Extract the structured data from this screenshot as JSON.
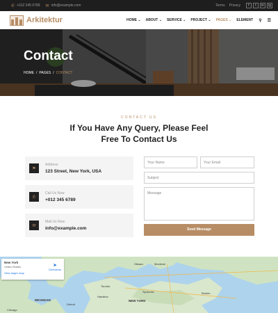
{
  "topbar": {
    "phone": "+012 345 6789",
    "email": "info@example.com",
    "links": [
      "Terms",
      "Privacy"
    ],
    "social": [
      "f",
      "t",
      "in",
      "ig"
    ]
  },
  "brand": {
    "name": "Arkitektur"
  },
  "nav": {
    "items": [
      {
        "label": "HOME ⌄",
        "active": false
      },
      {
        "label": "ABOUT ⌄",
        "active": false
      },
      {
        "label": "SERVICE ⌄",
        "active": false
      },
      {
        "label": "PROJECT ⌄",
        "active": false
      },
      {
        "label": "PAGES ⌄",
        "active": true
      },
      {
        "label": "ELEMENT",
        "active": false
      }
    ]
  },
  "hero": {
    "title": "Contact",
    "breadcrumb": {
      "home": "HOME",
      "sep": "/",
      "pages": "PAGES",
      "current": "CONTACT"
    }
  },
  "section": {
    "eyebrow": "CONTACT US",
    "headline_1": "If You Have Any Query, Please Feel",
    "headline_2": "Free To Contact Us"
  },
  "info": [
    {
      "label": "Address",
      "value": "123 Street, New York, USA",
      "icon": "map-pin-icon"
    },
    {
      "label": "Call Us Now",
      "value": "+012 345 6789",
      "icon": "phone-icon"
    },
    {
      "label": "Mail Us Now",
      "value": "info@example.com",
      "icon": "envelope-icon"
    }
  ],
  "form": {
    "name_placeholder": "Your Name",
    "email_placeholder": "Your Email",
    "subject_placeholder": "Subject",
    "message_placeholder": "Message",
    "submit_label": "Send Message"
  },
  "map": {
    "card_title": "New York",
    "card_subtitle": "United States",
    "card_link": "View larger map",
    "directions": "Directions",
    "labels": [
      "Ottawa",
      "Montreal",
      "Toronto",
      "Detroit",
      "Syracuse",
      "Boston",
      "NEW YORK",
      "MICHIGAN",
      "Hamilton",
      "Chicago"
    ]
  },
  "colors": {
    "accent": "#b78d65",
    "dark": "#1e1e1e"
  }
}
